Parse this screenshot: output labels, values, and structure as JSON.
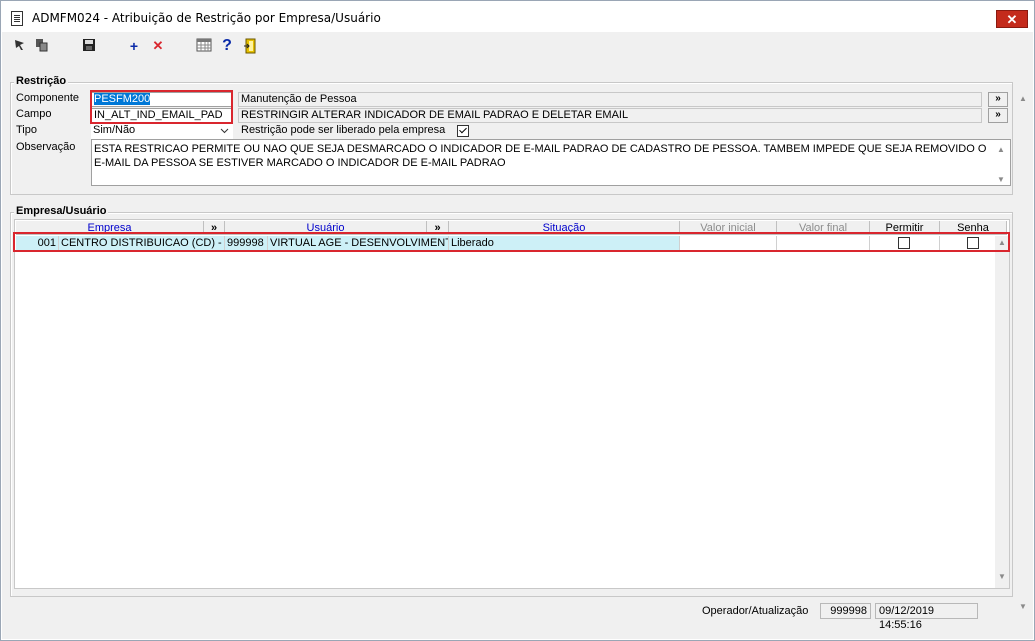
{
  "window": {
    "title": "ADMFM024 - Atribuição de Restrição por Empresa/Usuário",
    "close_label": "✕"
  },
  "toolbar": {
    "icons": [
      "cursor-icon",
      "copy-icon",
      "save-icon",
      "add-icon",
      "delete-icon",
      "calendar-icon",
      "help-icon",
      "exit-door-icon"
    ],
    "add_glyph": "+",
    "delete_glyph": "✕",
    "help_glyph": "?"
  },
  "restricao": {
    "group_label": "Restrição",
    "componente_label": "Componente",
    "componente_value": "PESFM200",
    "componente_desc": "Manutenção de Pessoa",
    "campo_label": "Campo",
    "campo_value": "IN_ALT_IND_EMAIL_PAD",
    "campo_desc": "RESTRINGIR ALTERAR INDICADOR DE EMAIL PADRAO E DELETAR EMAIL",
    "tipo_label": "Tipo",
    "tipo_value": "Sim/Não",
    "liberado_label": "Restrição pode ser liberado pela empresa",
    "liberado_checked": true,
    "obs_label": "Observação",
    "obs_value": "ESTA RESTRICAO PERMITE OU NAO QUE SEJA DESMARCADO O INDICADOR DE E-MAIL PADRAO DE CADASTRO DE PESSOA. TAMBEM IMPEDE QUE SEJA REMOVIDO O E-MAIL DA PESSOA SE ESTIVER MARCADO O INDICADOR DE E-MAIL PADRAO",
    "more_btn": "»"
  },
  "empresa_usuario": {
    "group_label": "Empresa/Usuário",
    "columns": {
      "empresa": "Empresa",
      "more1": "»",
      "usuario": "Usuário",
      "more2": "»",
      "situacao": "Situação",
      "valor_inicial": "Valor inicial",
      "valor_final": "Valor final",
      "permitir": "Permitir",
      "senha": "Senha"
    },
    "rows": [
      {
        "empresa_cod": "001",
        "empresa_nome": "CENTRO DISTRIBUICAO (CD) - FAT",
        "usuario_cod": "999998",
        "usuario_nome": "VIRTUAL AGE - DESENVOLVIMENTO",
        "situacao": "Liberado",
        "valor_inicial": "",
        "valor_final": "",
        "permitir": false,
        "senha": false
      }
    ]
  },
  "footer": {
    "operador_label": "Operador/Atualização",
    "operador_value": "999998",
    "atualizacao_value": "09/12/2019 14:55:16"
  },
  "colors": {
    "highlight": "#d9262e",
    "selected_row": "#cdf0f7",
    "selected_text": "#0078d7",
    "link_header": "#0000cc"
  }
}
